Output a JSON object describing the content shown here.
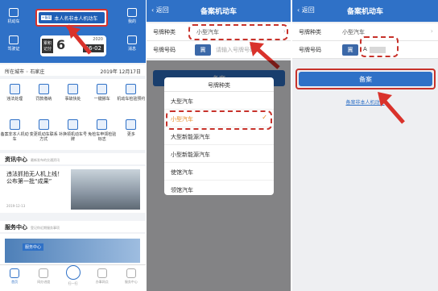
{
  "panel1": {
    "header": {
      "left_top": "机动车",
      "left_bottom": "驾驶证",
      "right_top": "我的",
      "right_bottom": "消息",
      "register_tag": "+备案",
      "register_label": "本人名非本人机动车",
      "card_score_label": "累积记分",
      "card_score": "6",
      "card_year": "2020",
      "card_date": "06-02"
    },
    "city_label": "所在城市",
    "city_value": "石家庄",
    "date": "2019年 12月17日",
    "grid_items": [
      "违法处理",
      "罚款缴纳",
      "事故快处",
      "一键挪车",
      "机动车检验预约",
      "备案非本人机动车",
      "变更机动车联系方式",
      "补换领机动车号牌",
      "免检车申领检验标志",
      "更多"
    ],
    "news_title": "资讯中心",
    "news_sub": "最新发布的交通资讯",
    "news_text": "违法抓拍无人机上线！公布第一批“成果”",
    "news_date": "2019-12-13",
    "service_title": "服务中心",
    "service_sub": "登记你近期服务事项",
    "service_badge": "服务中心",
    "tabs": [
      "首页",
      "网办进度",
      "扫一扫",
      "办事网点",
      "服务中心"
    ]
  },
  "panel2": {
    "back": "返回",
    "title": "备案机动车",
    "row1_label": "号牌种类",
    "row1_value": "小型汽车",
    "row2_label": "号牌号码",
    "plate_prov": "冀",
    "plate_placeholder": "请输入号牌号码",
    "submit": "备案",
    "picker_title": "号牌种类",
    "options": [
      "大型汽车",
      "小型汽车",
      "大型新能源汽车",
      "小型新能源汽车",
      "使馆汽车",
      "领馆汽车"
    ],
    "check": "✓"
  },
  "panel3": {
    "back": "返回",
    "title": "备案机动车",
    "row1_label": "号牌种类",
    "row1_value": "小型汽车",
    "row2_label": "号牌号码",
    "plate_prov": "冀",
    "plate_value": "A",
    "submit": "备案",
    "link": "备案非本人机动车"
  },
  "colors": {
    "primary": "#2f71c7",
    "highlight": "#c7322b",
    "selected": "#e58a22"
  }
}
